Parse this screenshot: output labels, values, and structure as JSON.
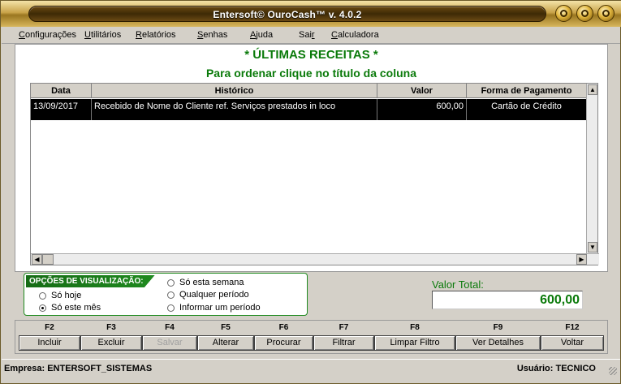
{
  "window": {
    "title": "Entersoft© OuroCash™ v. 4.0.2"
  },
  "menu": [
    {
      "label": "Configurações"
    },
    {
      "label": "Utilitários"
    },
    {
      "label": "Relatórios"
    },
    {
      "label": "Senhas"
    },
    {
      "label": "Ajuda"
    },
    {
      "label": "Sair"
    },
    {
      "label": "Calculadora"
    }
  ],
  "page": {
    "title": "* ÚLTIMAS RECEITAS *",
    "subtitle": "Para ordenar clique no título da coluna"
  },
  "table": {
    "columns": [
      "Data",
      "Histórico",
      "Valor",
      "Forma de Pagamento"
    ],
    "rows": [
      [
        "13/09/2017",
        "Recebido de Nome do Cliente ref. Serviços prestados in loco",
        "600,00",
        "Cartão de Crédito"
      ]
    ]
  },
  "view_options": {
    "label": "OPÇÕES DE VISUALIZAÇÃO:",
    "options": [
      "Só hoje",
      "Só este mês",
      "Só esta semana",
      "Qualquer período",
      "Informar um período"
    ],
    "selected": "Só este mês"
  },
  "total": {
    "label": "Valor Total:",
    "value": "600,00"
  },
  "buttons": [
    {
      "key": "F2",
      "label": "Incluir",
      "enabled": true
    },
    {
      "key": "F3",
      "label": "Excluir",
      "enabled": true
    },
    {
      "key": "F4",
      "label": "Salvar",
      "enabled": false
    },
    {
      "key": "F5",
      "label": "Alterar",
      "enabled": true
    },
    {
      "key": "F6",
      "label": "Procurar",
      "enabled": true
    },
    {
      "key": "F7",
      "label": "Filtrar",
      "enabled": true
    },
    {
      "key": "F8",
      "label": "Limpar Filtro",
      "enabled": true
    },
    {
      "key": "F9",
      "label": "Ver Detalhes",
      "enabled": true
    },
    {
      "key": "F12",
      "label": "Voltar",
      "enabled": true
    }
  ],
  "status": {
    "company": "Empresa: ENTERSOFT_SISTEMAS",
    "user": "Usuário: TECNICO"
  },
  "colors": {
    "accent_green": "#0a7a0a",
    "title_gold": "#c9a44a",
    "selected_row": "#000000"
  }
}
